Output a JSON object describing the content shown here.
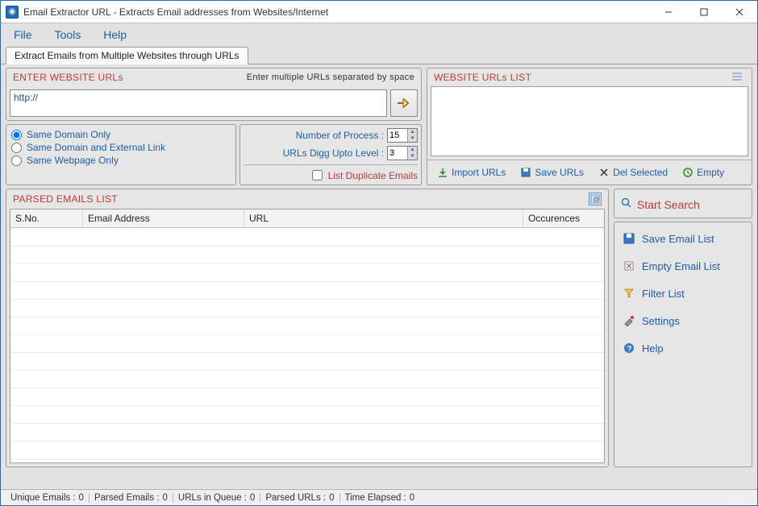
{
  "window": {
    "title": "Email Extractor URL - Extracts Email addresses from Websites/Internet"
  },
  "menu": {
    "file": "File",
    "tools": "Tools",
    "help": "Help"
  },
  "tab": {
    "label": "Extract Emails from Multiple Websites through URLs"
  },
  "enter_urls": {
    "title": "ENTER WEBSITE URLs",
    "hint": "Enter multiple URLs separated by space",
    "value": "http://"
  },
  "options": {
    "radio1": "Same Domain Only",
    "radio2": "Same Domain and External Link",
    "radio3": "Same Webpage Only",
    "selected": "radio1",
    "num_process_label": "Number of Process :",
    "num_process_value": "15",
    "digg_level_label": "URLs Digg Upto Level :",
    "digg_level_value": "3",
    "list_dup_label": "List Duplicate Emails"
  },
  "urls_list": {
    "title": "WEBSITE URLs LIST",
    "buttons": {
      "import": "Import URLs",
      "save": "Save URLs",
      "del": "Del Selected",
      "empty": "Empty"
    }
  },
  "parsed": {
    "title": "PARSED EMAILS LIST",
    "cols": {
      "sno": "S.No.",
      "email": "Email Address",
      "url": "URL",
      "occ": "Occurences"
    }
  },
  "side": {
    "start": "Start Search",
    "save_list": "Save Email List",
    "empty_list": "Empty Email List",
    "filter": "Filter List",
    "settings": "Settings",
    "help": "Help"
  },
  "status": {
    "unique_label": "Unique Emails :",
    "unique_value": "0",
    "parsed_label": "Parsed Emails :",
    "parsed_value": "0",
    "queue_label": "URLs in Queue :",
    "queue_value": "0",
    "purls_label": "Parsed URLs :",
    "purls_value": "0",
    "elapsed_label": "Time Elapsed :",
    "elapsed_value": "0"
  }
}
